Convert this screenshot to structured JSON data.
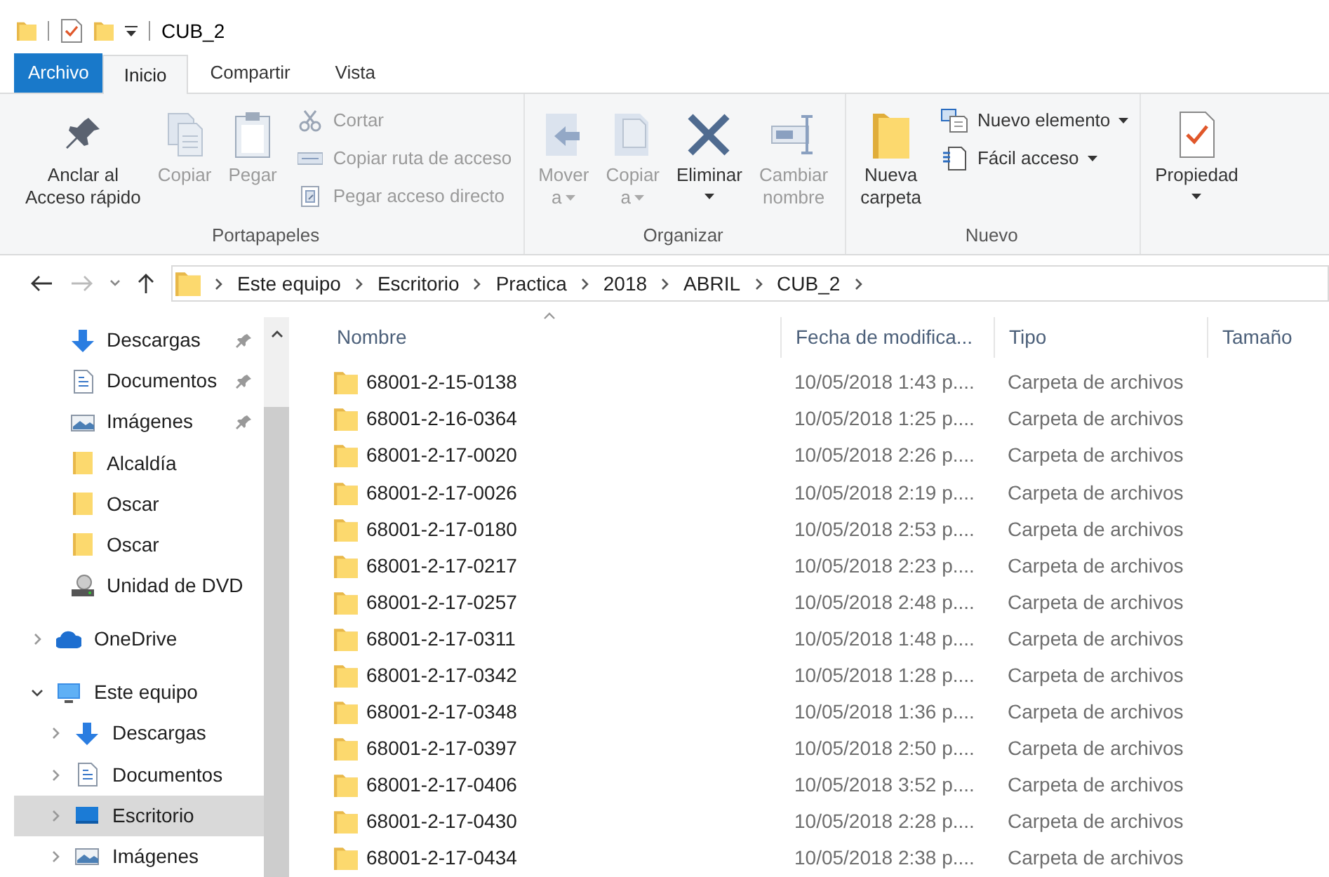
{
  "window": {
    "title": "CUB_2"
  },
  "tabs": [
    {
      "label": "Archivo",
      "kind": "file",
      "selected": false
    },
    {
      "label": "Inicio",
      "kind": "tab",
      "selected": true
    },
    {
      "label": "Compartir",
      "kind": "tab",
      "selected": false
    },
    {
      "label": "Vista",
      "kind": "tab",
      "selected": false
    }
  ],
  "ribbon": {
    "groups": [
      {
        "label": "Portapapeles",
        "buttons": [
          {
            "kind": "large",
            "label": "Anclar al\nAcceso rápido",
            "disabled": false,
            "dropdown": false
          },
          {
            "kind": "large",
            "label": "Copiar",
            "disabled": true,
            "dropdown": false
          },
          {
            "kind": "large",
            "label": "Pegar",
            "disabled": true,
            "dropdown": false
          },
          {
            "kind": "small",
            "label": "Cortar",
            "disabled": true,
            "dropdown": false
          },
          {
            "kind": "small",
            "label": "Copiar ruta de acceso",
            "disabled": true,
            "dropdown": false
          },
          {
            "kind": "small",
            "label": "Pegar acceso directo",
            "disabled": true,
            "dropdown": false
          }
        ]
      },
      {
        "label": "Organizar",
        "buttons": [
          {
            "kind": "large",
            "label": "Mover\na",
            "disabled": true,
            "dropdown": true
          },
          {
            "kind": "large",
            "label": "Copiar\na",
            "disabled": true,
            "dropdown": true
          },
          {
            "kind": "large",
            "label": "Eliminar",
            "disabled": false,
            "dropdown": true
          },
          {
            "kind": "large",
            "label": "Cambiar\nnombre",
            "disabled": true,
            "dropdown": false
          }
        ]
      },
      {
        "label": "Nuevo",
        "buttons": [
          {
            "kind": "large",
            "label": "Nueva\ncarpeta",
            "disabled": false,
            "dropdown": false
          },
          {
            "kind": "small",
            "label": "Nuevo elemento",
            "disabled": false,
            "dropdown": true
          },
          {
            "kind": "small",
            "label": "Fácil acceso",
            "disabled": false,
            "dropdown": true
          }
        ]
      },
      {
        "buttons": [
          {
            "kind": "large",
            "label": "Propiedad",
            "disabled": false,
            "dropdown": true
          }
        ]
      }
    ]
  },
  "address": {
    "path": [
      "Este equipo",
      "Escritorio",
      "Practica",
      "2018",
      "ABRIL",
      "CUB_2"
    ]
  },
  "navigation": {
    "quick_access": [
      {
        "label": "Descargas",
        "kind": "download",
        "pinned": true
      },
      {
        "label": "Documentos",
        "kind": "documents",
        "pinned": true
      },
      {
        "label": "Imágenes",
        "kind": "pictures",
        "pinned": true
      },
      {
        "label": "Alcaldía",
        "kind": "folder",
        "pinned": false
      },
      {
        "label": "Oscar",
        "kind": "folder",
        "pinned": false
      },
      {
        "label": "Oscar",
        "kind": "folder",
        "pinned": false
      },
      {
        "label": "Unidad de DVD",
        "kind": "dvd",
        "pinned": false
      }
    ],
    "tree": [
      {
        "label": "OneDrive",
        "kind": "cloud",
        "expanded": false,
        "selected": false
      },
      {
        "label": "Este equipo",
        "kind": "pc",
        "expanded": true,
        "selected": false,
        "children": [
          {
            "label": "Descargas",
            "kind": "download",
            "expanded": false,
            "selected": false
          },
          {
            "label": "Documentos",
            "kind": "documents",
            "expanded": false,
            "selected": false
          },
          {
            "label": "Escritorio",
            "kind": "desktop",
            "expanded": false,
            "selected": true
          },
          {
            "label": "Imágenes",
            "kind": "pictures",
            "expanded": false,
            "selected": false
          }
        ]
      }
    ]
  },
  "file_list": {
    "columns": [
      {
        "label": "Nombre",
        "sorted": true
      },
      {
        "label": "Fecha de modifica...",
        "sorted": false
      },
      {
        "label": "Tipo",
        "sorted": false
      },
      {
        "label": "Tamaño",
        "sorted": false
      }
    ],
    "rows": [
      {
        "name": "68001-2-15-0138",
        "date": "10/05/2018 1:43 p....",
        "type": "Carpeta de archivos"
      },
      {
        "name": "68001-2-16-0364",
        "date": "10/05/2018 1:25 p....",
        "type": "Carpeta de archivos"
      },
      {
        "name": "68001-2-17-0020",
        "date": "10/05/2018 2:26 p....",
        "type": "Carpeta de archivos"
      },
      {
        "name": "68001-2-17-0026",
        "date": "10/05/2018 2:19 p....",
        "type": "Carpeta de archivos"
      },
      {
        "name": "68001-2-17-0180",
        "date": "10/05/2018 2:53 p....",
        "type": "Carpeta de archivos"
      },
      {
        "name": "68001-2-17-0217",
        "date": "10/05/2018 2:23 p....",
        "type": "Carpeta de archivos"
      },
      {
        "name": "68001-2-17-0257",
        "date": "10/05/2018 2:48 p....",
        "type": "Carpeta de archivos"
      },
      {
        "name": "68001-2-17-0311",
        "date": "10/05/2018 1:48 p....",
        "type": "Carpeta de archivos"
      },
      {
        "name": "68001-2-17-0342",
        "date": "10/05/2018 1:28 p....",
        "type": "Carpeta de archivos"
      },
      {
        "name": "68001-2-17-0348",
        "date": "10/05/2018 1:36 p....",
        "type": "Carpeta de archivos"
      },
      {
        "name": "68001-2-17-0397",
        "date": "10/05/2018 2:50 p....",
        "type": "Carpeta de archivos"
      },
      {
        "name": "68001-2-17-0406",
        "date": "10/05/2018 3:52 p....",
        "type": "Carpeta de archivos"
      },
      {
        "name": "68001-2-17-0430",
        "date": "10/05/2018 2:28 p....",
        "type": "Carpeta de archivos"
      },
      {
        "name": "68001-2-17-0434",
        "date": "10/05/2018 2:38 p....",
        "type": "Carpeta de archivos"
      }
    ]
  }
}
